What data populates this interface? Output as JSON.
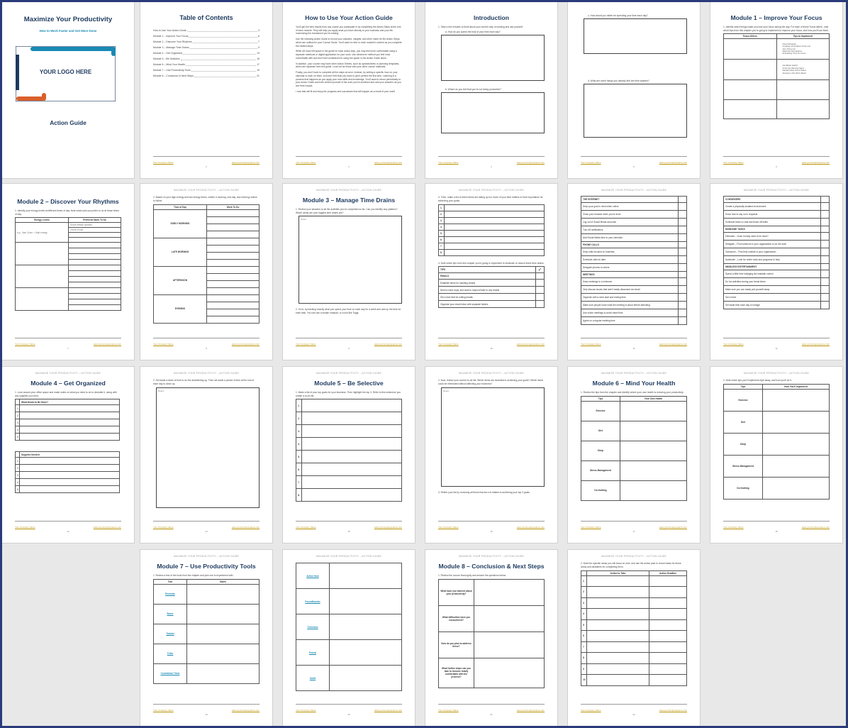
{
  "doc": {
    "header": "MAXIMIZE YOUR PRODUCTIVITY – ACTION GUIDE",
    "footer_left": "Your Company Name",
    "footer_right": "www.yourcompanyname.com"
  },
  "cover": {
    "title": "Maximize Your Productivity",
    "subtitle": "How to Work Faster and Get More Done",
    "logo": "YOUR LOGO HERE",
    "footer_title": "Action Guide",
    "colors": {
      "teal": "#1a8ab4",
      "orange": "#d9602b",
      "navy": "#1e3a5f"
    }
  },
  "toc": {
    "title": "Table of Contents",
    "page": "2",
    "entries": [
      {
        "label": "How to Use Your Action Guide",
        "page": "3"
      },
      {
        "label": "Module 1 – Improve Your Focus",
        "page": "6"
      },
      {
        "label": "Module 2 – Discover Your Rhythms",
        "page": "7"
      },
      {
        "label": "Module 3 – Manage Time Drains",
        "page": "9"
      },
      {
        "label": "Module 4 – Get Organized",
        "page": "13"
      },
      {
        "label": "Module 5 – Be Selective",
        "page": "15"
      },
      {
        "label": "Module 6 – Mind Your Health",
        "page": "17"
      },
      {
        "label": "Module 7 – Use Productivity Tools",
        "page": "19"
      },
      {
        "label": "Module 8 – Conclusion & Next Steps",
        "page": "21"
      }
    ]
  },
  "howto": {
    "title": "How to Use Your Action Guide",
    "page": "3",
    "paragraphs": [
      "You'll get the best results from any course you participate in by completing the Action Steps at the end of each module. They will help you apply what you learn directly to your business and your life, maximizing the investment you're making.",
      "Use the following Action Guide to record your answers, insights, and other notes for the Action Steps, which are outlined in your Course Guide. You'll want to refer to each module's content as you complete the related steps.",
      "While we have left space in the guide for each action step, you may feel more comfortable using a separate notebook or digital application for your work. Use whichever method you feel most comfortable with and don't feel constrained to using the space in the Action Guide alone.",
      "In addition, your course may have other Action Sheets, such as spreadsheets or planning templates, which are separate from this guide. Look out for those with your other course materials.",
      "Finally, you don't have to complete all the steps at once. Instead, try setting a specific hour on your calendar to work on them. And don't feel that you have to get it perfect the first time. Learning is a process that happens as you apply your new skills and knowledge. You'll want to return periodically to your Action Guide and both remind yourself of the work you've achieved and add your answers as you see their impact.",
      "I now that will fit and enjoy the progress and successes that will happen as a result of your work!"
    ]
  },
  "intro": {
    "title": "Introduction",
    "page": "4",
    "q1": "1. Take a few minutes to think about your current way of working and ask yourself:",
    "qa": "a. How do you spend the bulk of your time each day?",
    "qb": "b. Where do you feel that you're not being productive?"
  },
  "intro2": {
    "page": "5",
    "qc": "c. How would you rather be spending your time each day?",
    "qd": "d. What are some things you already feel are time wasters?"
  },
  "m1": {
    "title": "Module 1 – Improve Your Focus",
    "page": "6",
    "instr": "1. Identify which things make you lose your focus during the day. For each of these 'focus killers', note which tips from this chapter you're going to implement to improve your focus, and how you'll use them.",
    "headers": [
      "Focus Killers",
      "Tips to Implement"
    ],
    "tips1": [
      "Fixed Schedule",
      "Creating a Prioritized To-Do List",
      "One Thing List",
      "Minimize Interruptions",
      "Scheduling Time for Focus"
    ],
    "tips2": [
      "Get Better Habits",
      "Know the Warning Signs",
      "Identify Other Focus Killers",
      "Develop a Pre-Work Ritual"
    ]
  },
  "m2": {
    "title": "Module 2 – Discover Your Rhythms",
    "page": "7",
    "instr": "1. Identify your energy levels at different times of day. Note what work you prefer to do at those times of day.",
    "headers": [
      "Energy Levels",
      "Preferred Work To Do"
    ],
    "ex_energy": "e.g., 9am-11am = High energy",
    "ex_work1": "Social Media Updates",
    "ex_work2": "Check Email"
  },
  "m2b": {
    "page": "8",
    "instr": "2. Based on your high-energy and low-energy times, outline a morning, mid-day, and evening routine to follow.",
    "headers": [
      "Time of Day",
      "Work To Do"
    ],
    "times": [
      "EARLY MORNING",
      "LATE MORNING",
      "AFTERNOON",
      "EVENING"
    ]
  },
  "m3": {
    "title": "Module 3 – Manage Time Drains",
    "page": "9",
    "instr": "1. Review your answers to all the activities you've completed so far. Can you identify any patterns? Which areas are your biggest time drains are?",
    "box_label": "Notes:",
    "instr2": "2. If not, try tracking exactly what you spend your time on each day for a week and add up the time for each task. You can use a simple notepad, or a tool like Toggl."
  },
  "m3b": {
    "page": "10",
    "instr": "3. Then, make a list of which items are taking up too much of your time relative to their importance for achieving your goals.",
    "numbers": [
      "1.",
      "2.",
      "3.",
      "4.",
      "5.",
      "6.",
      "7.",
      "8."
    ],
    "instr2": "4. Note which tips from this chapter you're going to implement to eliminate or reduce these time drains.",
    "tips_header": "TIPS",
    "emails_header": "EMAILS",
    "emails": [
      "Establish times for handling emails",
      "Need a short reply, and want to respond later to any emails",
      "Set a time limit for writing emails",
      "Organize your email inbox with separate folders"
    ]
  },
  "m3c": {
    "page": "11",
    "sections": [
      {
        "head": "THE INTERNET",
        "items": [
          "Keep your goal in mind when online",
          "Close your browser when you're done",
          "Log out of Social Media accounts",
          "Turn off notifications",
          "Add Social Media time to your schedule"
        ]
      },
      {
        "head": "PHONE CALLS",
        "items": [
          "Keep calls focused on business",
          "Schedule calls for later",
          "Delegate phones to others"
        ]
      },
      {
        "head": "MEETINGS",
        "items": [
          "Keep meetings to a minimum",
          "Only discuss issues that aren't easily discussed via email",
          "Organize with a clear start and ending time",
          "Make sure people know what the meeting is about before attending",
          "Use online meetings to avoid travel time",
          "Agree on a regular meeting time"
        ]
      }
    ]
  },
  "m3d": {
    "page": "12",
    "sections": [
      {
        "head": "COWORKERS",
        "items": [
          "Create a physically isolated environment",
          "Know how to say no to requests",
          "Schedule times to chat and those off-limits"
        ]
      },
      {
        "head": "MUNDANE TASKS",
        "items": [
          "Eliminate – Does it really need to be done?",
          "Delegate – Find someone in your organization to do the work",
          "Outsource – Find help outside of your organization",
          "Automate – Look for online tools and programs to help"
        ]
      },
      {
        "head": "MINDLESS ENTERTAINMENT",
        "items": [
          "Spend a little time indulging but maintain control",
          "Do fun activities during your break times",
          "Make sure you can easily pull yourself away",
          "Set a timer",
          "Set aside time each day to indulge"
        ]
      }
    ]
  },
  "m4": {
    "title": "Module 4 – Get Organized",
    "page": "13",
    "instr": "1. Look around your office space and make notes on what you need to do to declutter it, along with any supplies you need.",
    "h1": "What Needs to Be Done?",
    "h2": "Supplies Needed",
    "numbers": [
      "1",
      "2",
      "3",
      "4",
      "5"
    ]
  },
  "m4b": {
    "page": "14",
    "instr": "2. Set aside a block of time to do the decluttering up. Then set aside a period of time at the end of each day to clean up.",
    "box_label": "Notes:"
  },
  "m5": {
    "title": "Module 5 – Be Selective",
    "page": "15",
    "instr": "1. Make a list of your top goals for your business. Then highlight the top 3. Refer to this whenever you create a to-do list.",
    "numbers": [
      "1.",
      "2.",
      "3.",
      "4.",
      "5.",
      "6.",
      "7.",
      "8."
    ]
  },
  "m5b": {
    "page": "16",
    "instr": "2. Now, review your current to-do list. Which items are essential to achieving your goals? Which items could be eliminated without affecting your business?",
    "box_label": "Notes:",
    "instr2": "3. Refine your list by removing all items that are not related to achieving your top 3 goals."
  },
  "m6": {
    "title": "Module 6 – Mind Your Health",
    "page": "17",
    "instr": "1. Review the tips from the chapter and identify where your own health is reducing your productivity.",
    "headers": [
      "Tips",
      "Your Own Health"
    ],
    "rows": [
      "Exercise",
      "Diet",
      "Sleep",
      "Stress Management",
      "Do Nothing"
    ]
  },
  "m6b": {
    "page": "18",
    "instr": "2. Note which tips you'll implement right away, and how you'll do it.",
    "headers": [
      "Tips",
      "How You'll Implement"
    ],
    "rows": [
      "Exercise",
      "Diet",
      "Sleep",
      "Stress Management",
      "Do Nothing"
    ]
  },
  "m7": {
    "title": "Module 7 – Use Productivity Tools",
    "page": "19",
    "instr": "1. Review a few of the tools from the chapter and pick one to experiment with.",
    "headers": [
      "Tool",
      "Notes"
    ],
    "tools": [
      "Evernote",
      "Boxer",
      "Todoist",
      "Trello",
      "Countdown Timer"
    ]
  },
  "m7b": {
    "page": "20",
    "tools": [
      "Action Now",
      "FocusBooster",
      "Checkbox",
      "Focusi",
      "Sortd"
    ]
  },
  "m8": {
    "title": "Module 8 – Conclusion & Next Steps",
    "page": "21",
    "instr": "1. Review the course thoroughly and answer the questions below.",
    "questions": [
      "What have you learned about your productivity?",
      "What difficulties have you encountered?",
      "How do you plan to address these?",
      "What further steps can you take to become totally comfortable with the process?"
    ]
  },
  "m8b": {
    "page": "22",
    "instr": "2. Note the specific areas you will focus on next, and use the action plan to record tasks for those areas and deadlines for completing them.",
    "headers": [
      "Action to Take",
      "Action Deadline"
    ],
    "numbers": [
      "1",
      "2",
      "3",
      "4",
      "5",
      "6",
      "7",
      "8",
      "9",
      "10"
    ]
  }
}
